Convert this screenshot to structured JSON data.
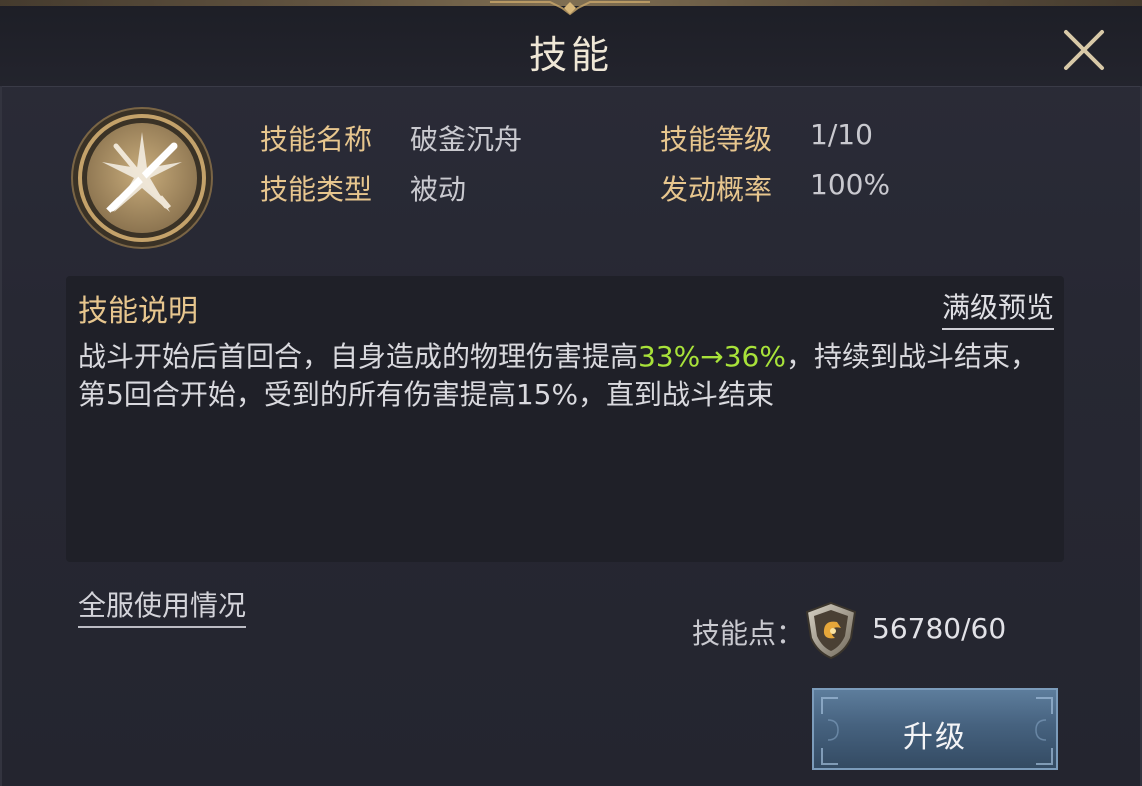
{
  "header": {
    "title": "技能"
  },
  "skill_info": {
    "name_label": "技能名称",
    "name_value": "破釜沉舟",
    "type_label": "技能类型",
    "type_value": "被动",
    "level_label": "技能等级",
    "level_value": "1/10",
    "chance_label": "发动概率",
    "chance_value": "100%"
  },
  "description": {
    "title": "技能说明",
    "max_level_preview": "满级预览",
    "text_part1": "战斗开始后首回合，自身造成的物理伤害提高",
    "text_highlight": "33%→36%",
    "text_part2": "，持续到战斗结束，第5回合开始，受到的所有伤害提高15%，直到战斗结束"
  },
  "server_usage_link": "全服使用情况",
  "skill_points": {
    "label": "技能点：",
    "value": "56780/60"
  },
  "upgrade_button": "升级",
  "colors": {
    "gold_label": "#e7c68e",
    "highlight_green": "#a8e23a",
    "button_blue": "#46627f"
  },
  "icons": {
    "close": "close-icon",
    "skill": "crossed-swords-icon",
    "points": "shield-icon"
  }
}
